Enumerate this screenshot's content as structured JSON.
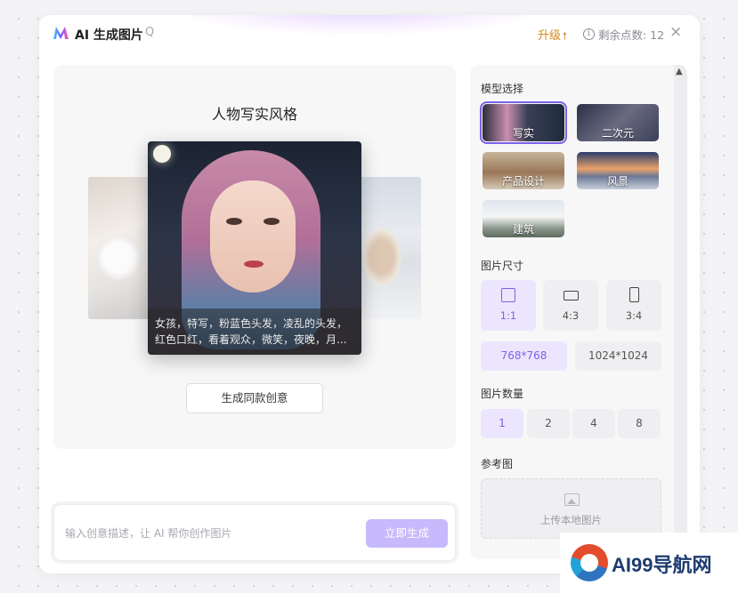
{
  "header": {
    "app_title": "AI 生成图片",
    "help_label": "Q",
    "upgrade_label": "升级",
    "upgrade_icon": "arrow-up-icon",
    "points_label": "剩余点数: 12",
    "close_icon": "×"
  },
  "preview": {
    "style_title": "人物写实风格",
    "caption": "女孩，特写，粉蓝色头发，凌乱的头发，红色口红，看着观众，微笑，夜晚，月...",
    "same_button": "生成同款创意"
  },
  "prompt": {
    "placeholder": "输入创意描述，让 AI 帮你创作图片",
    "generate_button": "立即生成"
  },
  "panel": {
    "model_label": "模型选择",
    "models": [
      {
        "name": "写实",
        "selected": true
      },
      {
        "name": "二次元",
        "selected": false
      },
      {
        "name": "产品设计",
        "selected": false
      },
      {
        "name": "风景",
        "selected": false
      },
      {
        "name": "建筑",
        "selected": false
      }
    ],
    "size_label": "图片尺寸",
    "sizes": [
      "1:1",
      "4:3",
      "3:4"
    ],
    "selected_size": "1:1",
    "resolutions": [
      "768*768",
      "1024*1024"
    ],
    "selected_resolution": "768*768",
    "count_label": "图片数量",
    "counts": [
      "1",
      "2",
      "4",
      "8"
    ],
    "selected_count": "1",
    "reference_label": "参考图",
    "upload_label": "上传本地图片"
  },
  "watermark": {
    "text": "AI99导航网"
  },
  "colors": {
    "accent": "#7b61e8",
    "upgrade": "#d4881a",
    "generate_button": "#c7b9fb"
  }
}
